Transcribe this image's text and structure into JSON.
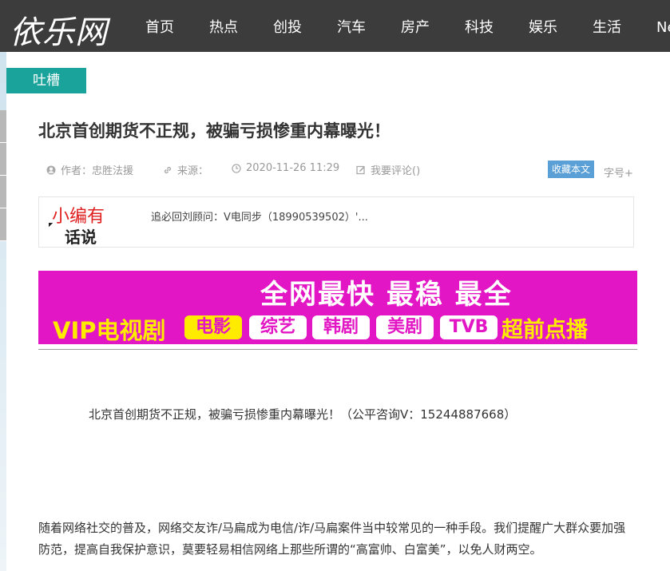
{
  "header": {
    "logo": "依乐网",
    "nav": [
      "首页",
      "热点",
      "创投",
      "汽车",
      "房产",
      "科技",
      "娱乐",
      "生活",
      "Nex"
    ]
  },
  "category_tag": "吐槽",
  "article": {
    "title": "北京首创期货不正规，被骗亏损惨重内幕曝光！",
    "author": "作者：忠胜法援",
    "source": "来源：",
    "date": "2020-11-26 11:29",
    "comment": "我要评论()",
    "favorite_button": "收藏本文",
    "font_size": "字号+"
  },
  "editor_box": {
    "logo_line1": "小编有",
    "logo_line2": "话说",
    "text": "追必回刘顾问：V电同步（18990539502）'..."
  },
  "banner": {
    "line1": "全网最快 最稳 最全",
    "line2": "VIP电视剧",
    "pills": [
      "电影",
      "综艺",
      "韩剧",
      "美剧",
      "TVB"
    ],
    "line3": "超前点播"
  },
  "body": {
    "lead": "北京首创期货不正规，被骗亏损惨重内幕曝光！（公平咨询V：15244887668）",
    "paragraph": "随着网络社交的普及，网络交友诈/马扁成为电信/诈/马扁案件当中较常见的一种手段。我们提醒广大群众要加强防范，提高自我保护意识，莫要轻易相信网络上那些所谓的“高富帅、白富美”，以免人财两空。"
  },
  "colors": {
    "topbar": "#3c3c3c",
    "tag": "#1aa39a",
    "banner": "#e216c4",
    "favorite": "#5a9fd6"
  }
}
